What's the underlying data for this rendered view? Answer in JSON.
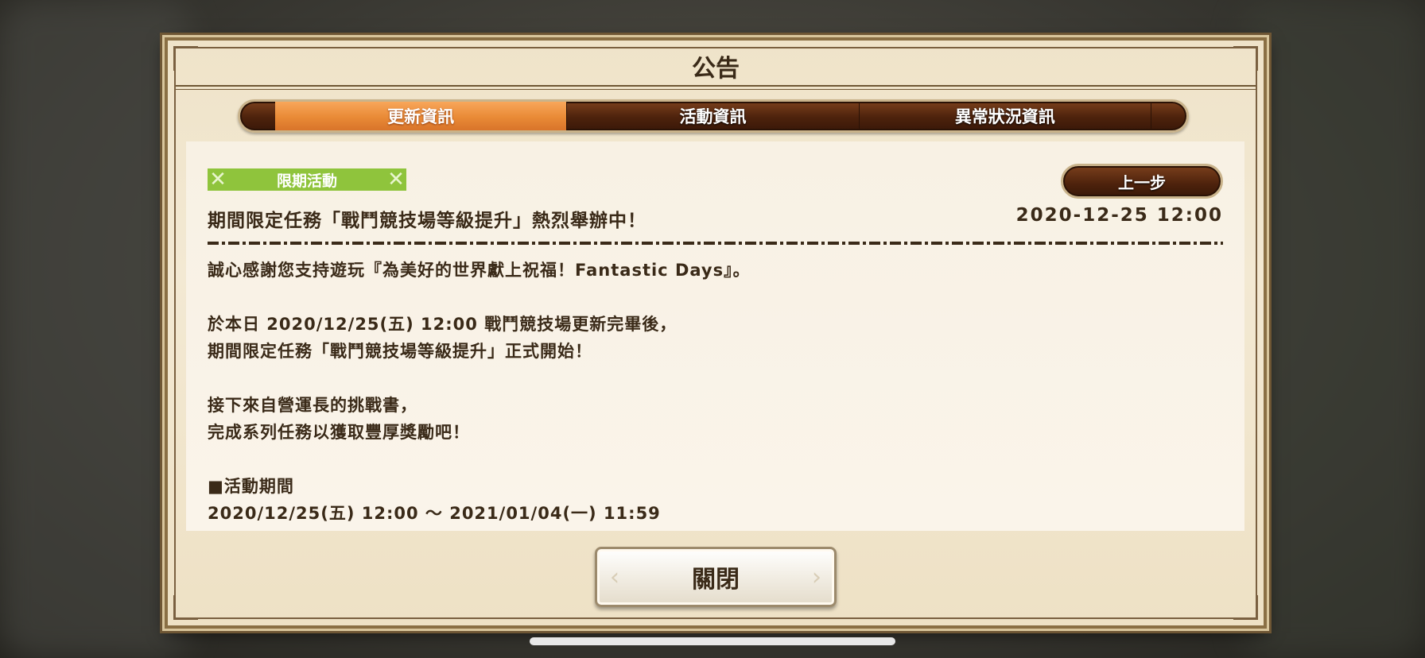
{
  "dialog": {
    "title": "公告",
    "tabs": [
      {
        "label": "更新資訊",
        "active": true
      },
      {
        "label": "活動資訊",
        "active": false
      },
      {
        "label": "異常狀況資訊",
        "active": false
      }
    ],
    "badge": "限期活動",
    "back_label": "上一步",
    "headline": "期間限定任務「戰鬥競技場等級提升」熱烈舉辦中！",
    "date": "2020-12-25 12:00",
    "body": [
      "誠心感謝您支持遊玩『為美好的世界獻上祝福！Fantastic Days』。",
      "",
      "於本日 2020/12/25(五) 12:00 戰鬥競技場更新完畢後，",
      "期間限定任務「戰鬥競技場等級提升」正式開始！",
      "",
      "接下來自營運長的挑戰書，",
      "完成系列任務以獲取豐厚獎勵吧！",
      "",
      "■活動期間",
      "2020/12/25(五) 12:00 〜 2021/01/04(一) 11:59"
    ],
    "close_label": "關閉"
  },
  "colors": {
    "tab_active": "#e98a36",
    "tab_bar": "#4d220c",
    "badge": "#8fc43c",
    "panel": "#f3e9d3"
  }
}
